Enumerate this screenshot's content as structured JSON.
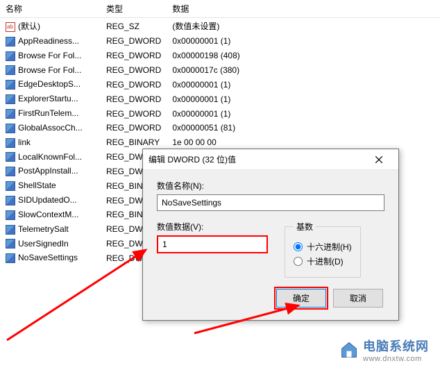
{
  "columns": {
    "name": "名称",
    "type": "类型",
    "data": "数据"
  },
  "rows": [
    {
      "icon": "ab",
      "name": "(默认)",
      "type": "REG_SZ",
      "data": "(数值未设置)"
    },
    {
      "icon": "bin",
      "name": "AppReadiness...",
      "type": "REG_DWORD",
      "data": "0x00000001 (1)"
    },
    {
      "icon": "bin",
      "name": "Browse For Fol...",
      "type": "REG_DWORD",
      "data": "0x00000198 (408)"
    },
    {
      "icon": "bin",
      "name": "Browse For Fol...",
      "type": "REG_DWORD",
      "data": "0x0000017c (380)"
    },
    {
      "icon": "bin",
      "name": "EdgeDesktopS...",
      "type": "REG_DWORD",
      "data": "0x00000001 (1)"
    },
    {
      "icon": "bin",
      "name": "ExplorerStartu...",
      "type": "REG_DWORD",
      "data": "0x00000001 (1)"
    },
    {
      "icon": "bin",
      "name": "FirstRunTelem...",
      "type": "REG_DWORD",
      "data": "0x00000001 (1)"
    },
    {
      "icon": "bin",
      "name": "GlobalAssocCh...",
      "type": "REG_DWORD",
      "data": "0x00000051 (81)"
    },
    {
      "icon": "bin",
      "name": "link",
      "type": "REG_BINARY",
      "data": "1e 00 00 00"
    },
    {
      "icon": "bin",
      "name": "LocalKnownFol...",
      "type": "REG_DWORD",
      "data": ""
    },
    {
      "icon": "bin",
      "name": "PostAppInstall...",
      "type": "REG_DWORD",
      "data": ""
    },
    {
      "icon": "bin",
      "name": "ShellState",
      "type": "REG_BINARY",
      "data": ""
    },
    {
      "icon": "bin",
      "name": "SIDUpdatedO...",
      "type": "REG_DWORD",
      "data": ""
    },
    {
      "icon": "bin",
      "name": "SlowContextM...",
      "type": "REG_BINARY",
      "data": ""
    },
    {
      "icon": "bin",
      "name": "TelemetrySalt",
      "type": "REG_DWORD",
      "data": ""
    },
    {
      "icon": "bin",
      "name": "UserSignedIn",
      "type": "REG_DWORD",
      "data": ""
    },
    {
      "icon": "bin",
      "name": "NoSaveSettings",
      "type": "REG_DWORD",
      "data": ""
    }
  ],
  "dialog": {
    "title": "编辑 DWORD (32 位)值",
    "name_label": "数值名称(N):",
    "name_value": "NoSaveSettings",
    "data_label": "数值数据(V):",
    "data_value": "1",
    "radix_label": "基数",
    "radix_hex": "十六进制(H)",
    "radix_dec": "十进制(D)",
    "ok": "确定",
    "cancel": "取消"
  },
  "watermark": {
    "cn": "电脑系统网",
    "url": "www.dnxtw.com"
  }
}
